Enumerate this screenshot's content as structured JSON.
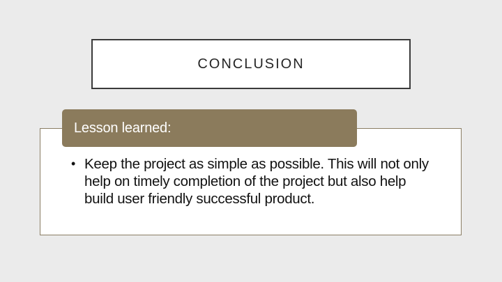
{
  "slide": {
    "title": "CONCLUSION",
    "section_heading": "Lesson learned:",
    "bullets": [
      "Keep the project as simple as possible. This will not only help on timely completion of the project but also help build user friendly successful product."
    ]
  },
  "colors": {
    "background": "#ebebeb",
    "header_band": "#8b7b5c",
    "content_border": "#8b7e64",
    "title_border": "#3a3a3a"
  }
}
